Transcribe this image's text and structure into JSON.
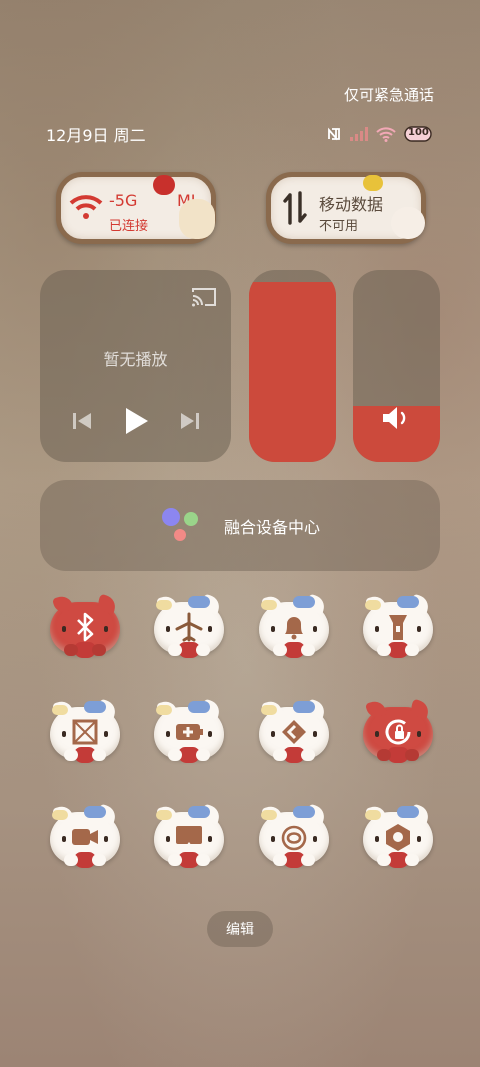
{
  "status_bar": {
    "emergency_text": "仅可紧急通话",
    "date": "12月9日 周二",
    "icons": [
      "nfc-icon",
      "signal-icon",
      "wifi-icon",
      "battery-icon"
    ],
    "battery_label": "100"
  },
  "toggles": {
    "wifi": {
      "name_fragment_left": "-5G",
      "name_fragment_right": "MI",
      "status": "已连接",
      "icon": "wifi-icon"
    },
    "mobile_data": {
      "name": "移动数据",
      "status": "不可用",
      "icon": "data-transfer-icon"
    }
  },
  "media": {
    "title": "暂无播放",
    "icons": [
      "cast-icon",
      "previous-icon",
      "play-icon",
      "next-icon"
    ]
  },
  "brightness": {
    "level": 0.94
  },
  "volume": {
    "level": 0.29,
    "icon": "speaker-icon"
  },
  "device_center": {
    "label": "融合设备中心"
  },
  "quick_tiles": [
    {
      "icon": "bluetooth-icon",
      "active": true
    },
    {
      "icon": "airplane-icon",
      "active": false
    },
    {
      "icon": "bell-icon",
      "active": false
    },
    {
      "icon": "flashlight-icon",
      "active": false
    },
    {
      "icon": "screenshot-icon",
      "active": false
    },
    {
      "icon": "battery-saver-icon",
      "active": false
    },
    {
      "icon": "link-icon",
      "active": false
    },
    {
      "icon": "rotation-lock-icon",
      "active": true
    },
    {
      "icon": "screen-record-icon",
      "active": false
    },
    {
      "icon": "screen-cast-icon",
      "active": false
    },
    {
      "icon": "nfc-tile-icon",
      "active": false
    },
    {
      "icon": "camera-icon",
      "active": false
    }
  ],
  "edit_label": "编辑",
  "colors": {
    "accent": "#cc4a3c",
    "panel": "#6e6254"
  }
}
